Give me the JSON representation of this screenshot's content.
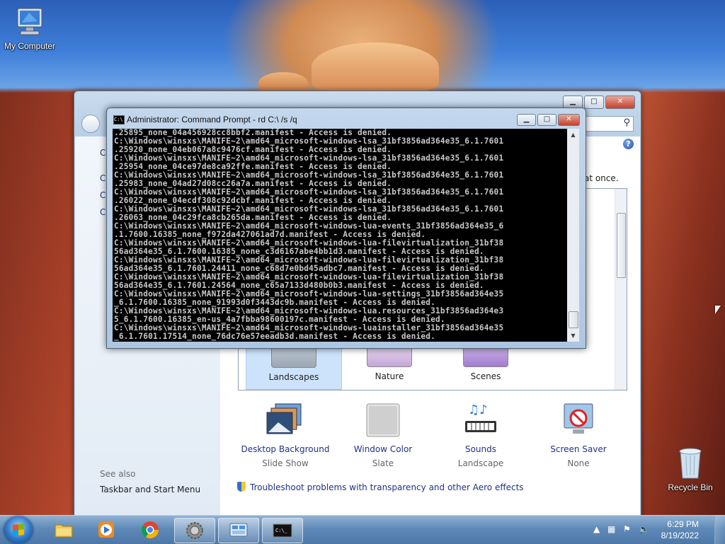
{
  "desktop": {
    "icons": [
      {
        "label": "My Computer",
        "icon": "computer-icon"
      },
      {
        "label": "Recycle Bin",
        "icon": "recycle-bin-icon"
      }
    ]
  },
  "personalization": {
    "partial_left_links": [
      "C",
      "C",
      "C",
      "C"
    ],
    "see_also": "See also",
    "taskbar_link": "Taskbar and Start Menu",
    "clipped_text": "at once.",
    "themes": [
      {
        "label": "Landscapes",
        "selected": true
      },
      {
        "label": "Nature",
        "selected": false
      },
      {
        "label": "Scenes",
        "selected": false
      }
    ],
    "bottom_options": [
      {
        "label": "Desktop Background",
        "sub": "Slide Show",
        "icon": "desktop-background-icon"
      },
      {
        "label": "Window Color",
        "sub": "Slate",
        "icon": "window-color-icon"
      },
      {
        "label": "Sounds",
        "sub": "Landscape",
        "icon": "sounds-icon"
      },
      {
        "label": "Screen Saver",
        "sub": "None",
        "icon": "screen-saver-icon"
      }
    ],
    "troubleshoot": "Troubleshoot problems with transparency and other Aero effects"
  },
  "cmd": {
    "title": "Administrator: Command Prompt - rd  C:\\ /s /q",
    "icon_text": "C:\\",
    "lines": [
      ".25895_none_04a456928cc8bbf2.manifest - Access is denied.",
      "C:\\Windows\\winsxs\\MANIFE~2\\amd64_microsoft-windows-lsa_31bf3856ad364e35_6.1.7601",
      ".25920_none_04eb067a8c9476cf.manifest - Access is denied.",
      "C:\\Windows\\winsxs\\MANIFE~2\\amd64_microsoft-windows-lsa_31bf3856ad364e35_6.1.7601",
      ".25954_none_04ce97de8ca92ffe.manifest - Access is denied.",
      "C:\\Windows\\winsxs\\MANIFE~2\\amd64_microsoft-windows-lsa_31bf3856ad364e35_6.1.7601",
      ".25983_none_04ad27d08cc26a7a.manifest - Access is denied.",
      "C:\\Windows\\winsxs\\MANIFE~2\\amd64_microsoft-windows-lsa_31bf3856ad364e35_6.1.7601",
      ".26022_none_04ecdf308c92dcbf.manifest - Access is denied.",
      "C:\\Windows\\winsxs\\MANIFE~2\\amd64_microsoft-windows-lsa_31bf3856ad364e35_6.1.7601",
      ".26063_none_04c29fca8cb265da.manifest - Access is denied.",
      "C:\\Windows\\winsxs\\MANIFE~2\\amd64_microsoft-windows-lua-events_31bf3856ad364e35_6",
      ".1.7600.16385_none_f972da427061ad7d.manifest - Access is denied.",
      "C:\\Windows\\winsxs\\MANIFE~2\\amd64_microsoft-windows-lua-filevirtualization_31bf38",
      "56ad364e35_6.1.7600.16385_none_c3d6167abe4bb1d3.manifest - Access is denied.",
      "C:\\Windows\\winsxs\\MANIFE~2\\amd64_microsoft-windows-lua-filevirtualization_31bf38",
      "56ad364e35_6.1.7601.24411_none_c68d7e0bd45adbc7.manifest - Access is denied.",
      "C:\\Windows\\winsxs\\MANIFE~2\\amd64_microsoft-windows-lua-filevirtualization_31bf38",
      "56ad364e35_6.1.7601.24564_none_c65a7133d480b0b3.manifest - Access is denied.",
      "C:\\Windows\\winsxs\\MANIFE~2\\amd64_microsoft-windows-lua-settings_31bf3856ad364e35",
      "_6.1.7600.16385_none_91993d0f3443dc9b.manifest - Access is denied.",
      "C:\\Windows\\winsxs\\MANIFE~2\\amd64_microsoft-windows-lua.resources_31bf3856ad364e3",
      "5_6.1.7600.16385_en-us_4a7fbba98600197c.manifest - Access is denied.",
      "C:\\Windows\\winsxs\\MANIFE~2\\amd64_microsoft-windows-luainstaller_31bf3856ad364e35",
      "_6.1.7601.17514_none_76dc76e57eeadb3d.manifest - Access is denied."
    ]
  },
  "taskbar": {
    "buttons": [
      {
        "name": "explorer-taskbar-button",
        "icon": "folder-icon",
        "active": false
      },
      {
        "name": "media-player-taskbar-button",
        "icon": "media-player-icon",
        "active": false
      },
      {
        "name": "chrome-taskbar-button",
        "icon": "chrome-icon",
        "active": false
      },
      {
        "name": "control-panel-taskbar-button",
        "icon": "gear-icon",
        "active": true
      },
      {
        "name": "personalization-taskbar-button",
        "icon": "personalization-icon",
        "active": true
      },
      {
        "name": "cmd-taskbar-button",
        "icon": "cmd-icon",
        "active": true
      }
    ],
    "clock_time": "6:29 PM",
    "clock_date": "8/19/2022"
  }
}
